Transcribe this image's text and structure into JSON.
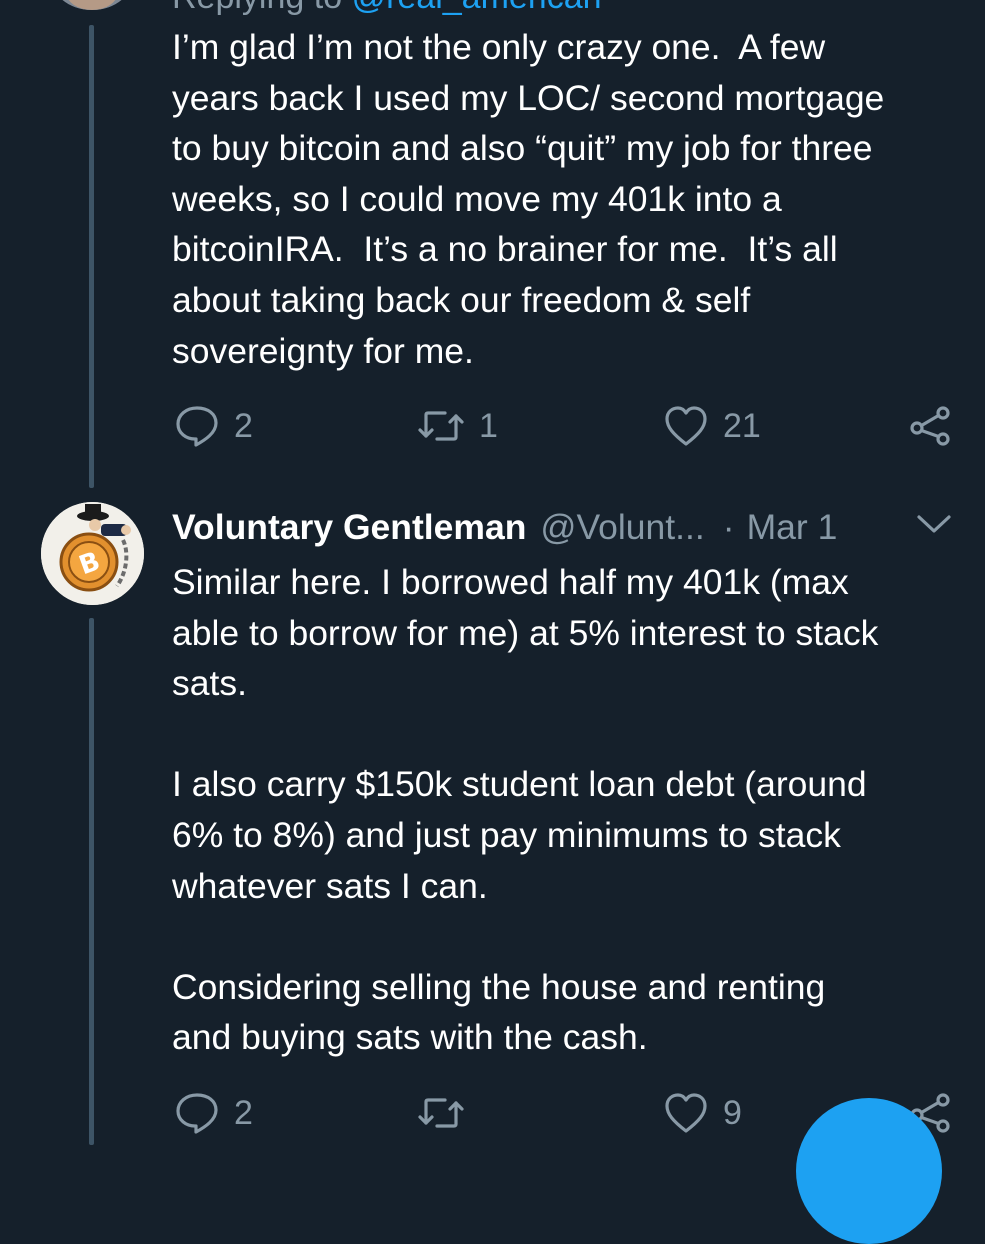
{
  "reply_context": {
    "prefix": "Replying to",
    "handle": "@real_american"
  },
  "tweets": [
    {
      "text": "I’m glad I’m not the only crazy one.  A few\nyears back I used my LOC/ second mortgage\nto buy bitcoin and also “quit” my job for three\nweeks, so I could move my 401k into a\nbitcoinIRA.  It’s a no brainer for me.  It’s all\nabout taking back our freedom & self\nsovereignty for me.",
      "replies": "2",
      "retweets": "1",
      "likes": "21"
    },
    {
      "name": "Voluntary Gentleman",
      "handle": "@Volunt...",
      "separator": "·",
      "date": "Mar 1",
      "text": "Similar here. I borrowed half my 401k (max\nable to borrow for me) at 5% interest to stack\nsats.\n\nI also carry $150k student loan debt (around\n6% to 8%) and just pay minimums to stack\nwhatever sats I can.\n\nConsidering selling the house and renting\nand buying sats with the cash.",
      "replies": "2",
      "retweets": "",
      "likes": "9"
    }
  ],
  "icons": {
    "reply": "reply-icon",
    "retweet": "retweet-icon",
    "like": "heart-icon",
    "share": "share-icon",
    "more": "chevron-down-icon",
    "compose": "compose-fab"
  },
  "colors": {
    "background": "#15202b",
    "text": "#ffffff",
    "muted": "#8899a6",
    "accent": "#1da1f2",
    "thread_line": "#3d5466"
  }
}
